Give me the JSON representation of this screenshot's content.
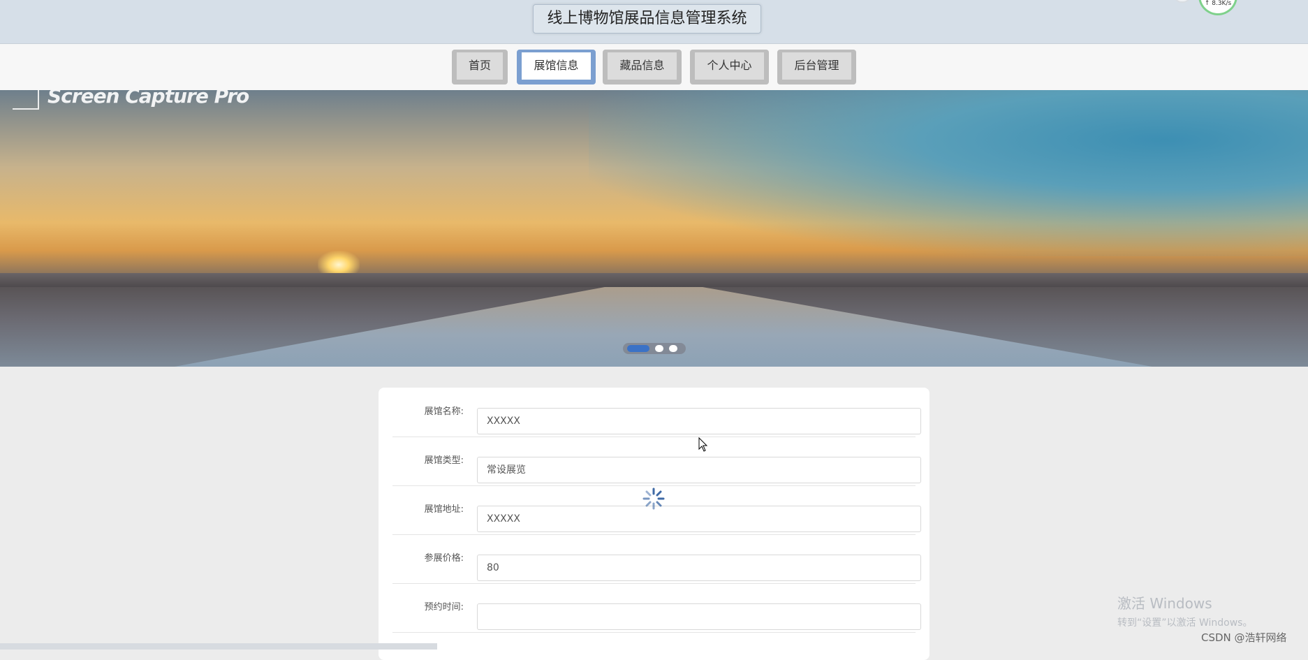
{
  "header": {
    "title": "线上博物馆展品信息管理系统",
    "speed": "↑ 8.3K/s"
  },
  "nav": {
    "items": [
      {
        "label": "首页",
        "active": false
      },
      {
        "label": "展馆信息",
        "active": true
      },
      {
        "label": "藏品信息",
        "active": false
      },
      {
        "label": "个人中心",
        "active": false
      },
      {
        "label": "后台管理",
        "active": false
      }
    ]
  },
  "banner": {
    "watermark": "Screen Capture Pro",
    "active_slide": 1,
    "slide_count": 3
  },
  "form": {
    "fields": [
      {
        "label": "展馆名称:",
        "value": "XXXXX"
      },
      {
        "label": "展馆类型:",
        "value": "常设展览"
      },
      {
        "label": "展馆地址:",
        "value": "XXXXX"
      },
      {
        "label": "参展价格:",
        "value": "80"
      },
      {
        "label": "预约时间:",
        "value": ""
      }
    ]
  },
  "overlay": {
    "activate_line1": "激活 Windows",
    "activate_line2": "转到“设置”以激活 Windows。",
    "credit": "CSDN @浩轩网络"
  },
  "colors": {
    "header_bg": "#d6dfe8",
    "nav_active_border": "#7b9fd0",
    "dot_active": "#3b72c6"
  }
}
